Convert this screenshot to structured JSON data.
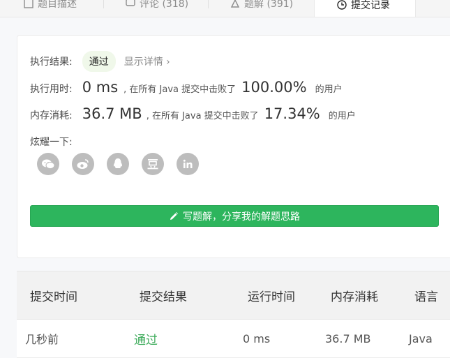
{
  "tabs": [
    {
      "label": "题目描述",
      "icon": "description-icon"
    },
    {
      "label": "评论 (318)",
      "icon": "comment-icon"
    },
    {
      "label": "题解 (391)",
      "icon": "solution-icon"
    },
    {
      "label": "提交记录",
      "icon": "clock-icon",
      "active": true
    }
  ],
  "result": {
    "status_label": "执行结果:",
    "status_value": "通过",
    "detail_link": "显示详情 ›",
    "runtime_label": "执行用时:",
    "runtime_value": "0 ms",
    "runtime_text": ", 在所有 Java 提交中击败了",
    "runtime_percent": "100.00%",
    "runtime_suffix": "的用户",
    "memory_label": "内存消耗:",
    "memory_value": "36.7 MB",
    "memory_text": ", 在所有 Java 提交中击败了",
    "memory_percent": "17.34%",
    "memory_suffix": "的用户",
    "share_label": "炫耀一下:",
    "share_icons": [
      "wechat-icon",
      "weibo-icon",
      "qq-icon",
      "douban-icon",
      "linkedin-icon"
    ],
    "write_button": "写题解，分享我的解题思路"
  },
  "table": {
    "headers": [
      "提交时间",
      "提交结果",
      "运行时间",
      "内存消耗",
      "语言"
    ],
    "rows": [
      {
        "time": "几秒前",
        "result": "通过",
        "runtime": "0 ms",
        "memory": "36.7 MB",
        "language": "Java"
      }
    ]
  },
  "colors": {
    "accent_green": "#2db55d",
    "pass_text": "#3cab5a"
  }
}
